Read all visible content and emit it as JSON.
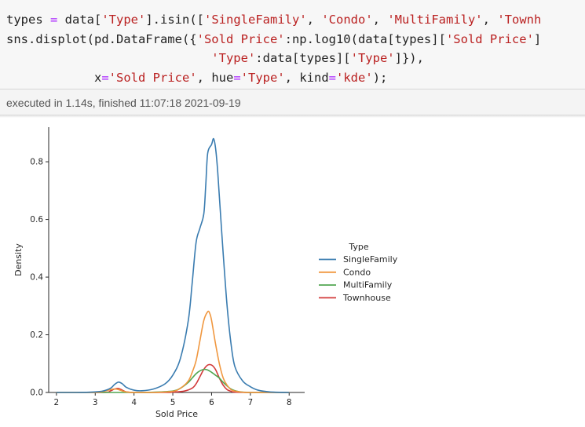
{
  "cell": {
    "code_lines": [
      [
        {
          "t": "types "
        },
        {
          "t": "=",
          "c": "op"
        },
        {
          "t": " data["
        },
        {
          "t": "'Type'",
          "c": "str"
        },
        {
          "t": "].isin(["
        },
        {
          "t": "'SingleFamily'",
          "c": "str"
        },
        {
          "t": ", "
        },
        {
          "t": "'Condo'",
          "c": "str"
        },
        {
          "t": ", "
        },
        {
          "t": "'MultiFamily'",
          "c": "str"
        },
        {
          "t": ", "
        },
        {
          "t": "'Townh",
          "c": "str"
        }
      ],
      [
        {
          "t": "sns.displot(pd.DataFrame({"
        },
        {
          "t": "'Sold Price'",
          "c": "str"
        },
        {
          "t": ":np.log10(data[types]["
        },
        {
          "t": "'Sold Price'",
          "c": "str"
        },
        {
          "t": "]"
        }
      ],
      [
        {
          "t": "                            "
        },
        {
          "t": "'Type'",
          "c": "str"
        },
        {
          "t": ":data[types]["
        },
        {
          "t": "'Type'",
          "c": "str"
        },
        {
          "t": "]}),"
        }
      ],
      [
        {
          "t": "            x"
        },
        {
          "t": "=",
          "c": "op"
        },
        {
          "t": "'Sold Price'",
          "c": "str"
        },
        {
          "t": ", hue"
        },
        {
          "t": "=",
          "c": "op"
        },
        {
          "t": "'Type'",
          "c": "str"
        },
        {
          "t": ", kind"
        },
        {
          "t": "=",
          "c": "op"
        },
        {
          "t": "'kde'",
          "c": "str"
        },
        {
          "t": ");"
        }
      ]
    ],
    "execution_status": "executed in 1.14s, finished 11:07:18 2021-09-19"
  },
  "colors": {
    "SingleFamily": "#3a7cb0",
    "Condo": "#f0973f",
    "MultiFamily": "#50a650",
    "Townhouse": "#d23a3a"
  },
  "chart_data": {
    "type": "line",
    "xlabel": "Sold Price",
    "ylabel": "Density",
    "xlim": [
      1.8,
      8.4
    ],
    "ylim": [
      0,
      0.92
    ],
    "xticks": [
      2,
      3,
      4,
      5,
      6,
      7,
      8
    ],
    "yticks": [
      0.0,
      0.2,
      0.4,
      0.6,
      0.8
    ],
    "legend": {
      "title": "Type",
      "placement": "right"
    },
    "series": [
      {
        "name": "SingleFamily",
        "x": [
          2.0,
          2.5,
          3.0,
          3.2,
          3.4,
          3.5,
          3.6,
          3.7,
          3.8,
          4.0,
          4.2,
          4.5,
          4.8,
          5.0,
          5.2,
          5.4,
          5.5,
          5.6,
          5.7,
          5.8,
          5.85,
          5.9,
          6.0,
          6.05,
          6.1,
          6.15,
          6.2,
          6.3,
          6.4,
          6.5,
          6.6,
          6.8,
          7.0,
          7.2,
          7.5,
          8.0
        ],
        "y": [
          0,
          0,
          0.002,
          0.005,
          0.015,
          0.028,
          0.036,
          0.03,
          0.018,
          0.008,
          0.006,
          0.012,
          0.03,
          0.06,
          0.12,
          0.25,
          0.38,
          0.52,
          0.57,
          0.62,
          0.72,
          0.83,
          0.86,
          0.88,
          0.85,
          0.78,
          0.68,
          0.48,
          0.3,
          0.17,
          0.09,
          0.04,
          0.02,
          0.008,
          0.002,
          0
        ]
      },
      {
        "name": "Condo",
        "x": [
          2.0,
          3.0,
          3.2,
          3.4,
          3.5,
          3.6,
          3.7,
          3.8,
          4.0,
          4.5,
          5.0,
          5.2,
          5.4,
          5.5,
          5.6,
          5.7,
          5.8,
          5.9,
          5.95,
          6.0,
          6.1,
          6.2,
          6.3,
          6.4,
          6.5,
          6.6,
          6.8,
          7.0,
          8.0
        ],
        "y": [
          0,
          0,
          0.004,
          0.01,
          0.012,
          0.01,
          0.005,
          0.002,
          0,
          0,
          0.004,
          0.015,
          0.04,
          0.07,
          0.11,
          0.18,
          0.25,
          0.28,
          0.275,
          0.25,
          0.17,
          0.1,
          0.05,
          0.025,
          0.01,
          0.005,
          0.001,
          0,
          0
        ]
      },
      {
        "name": "MultiFamily",
        "x": [
          2.0,
          4.0,
          4.5,
          5.0,
          5.2,
          5.4,
          5.5,
          5.6,
          5.7,
          5.8,
          5.9,
          6.0,
          6.1,
          6.2,
          6.3,
          6.5,
          6.7,
          7.0,
          8.0
        ],
        "y": [
          0,
          0,
          0.001,
          0.005,
          0.015,
          0.035,
          0.05,
          0.065,
          0.075,
          0.08,
          0.078,
          0.07,
          0.06,
          0.05,
          0.035,
          0.012,
          0.003,
          0,
          0
        ]
      },
      {
        "name": "Townhouse",
        "x": [
          2.0,
          3.2,
          3.4,
          3.5,
          3.6,
          3.7,
          3.8,
          4.0,
          4.8,
          5.0,
          5.3,
          5.5,
          5.6,
          5.7,
          5.8,
          5.9,
          6.0,
          6.1,
          6.2,
          6.3,
          6.4,
          6.5,
          6.6,
          7.0,
          8.0
        ],
        "y": [
          0,
          0,
          0.006,
          0.012,
          0.014,
          0.008,
          0.002,
          0,
          0,
          0.001,
          0.005,
          0.015,
          0.03,
          0.055,
          0.08,
          0.095,
          0.095,
          0.08,
          0.05,
          0.025,
          0.01,
          0.004,
          0.001,
          0,
          0
        ]
      }
    ]
  }
}
